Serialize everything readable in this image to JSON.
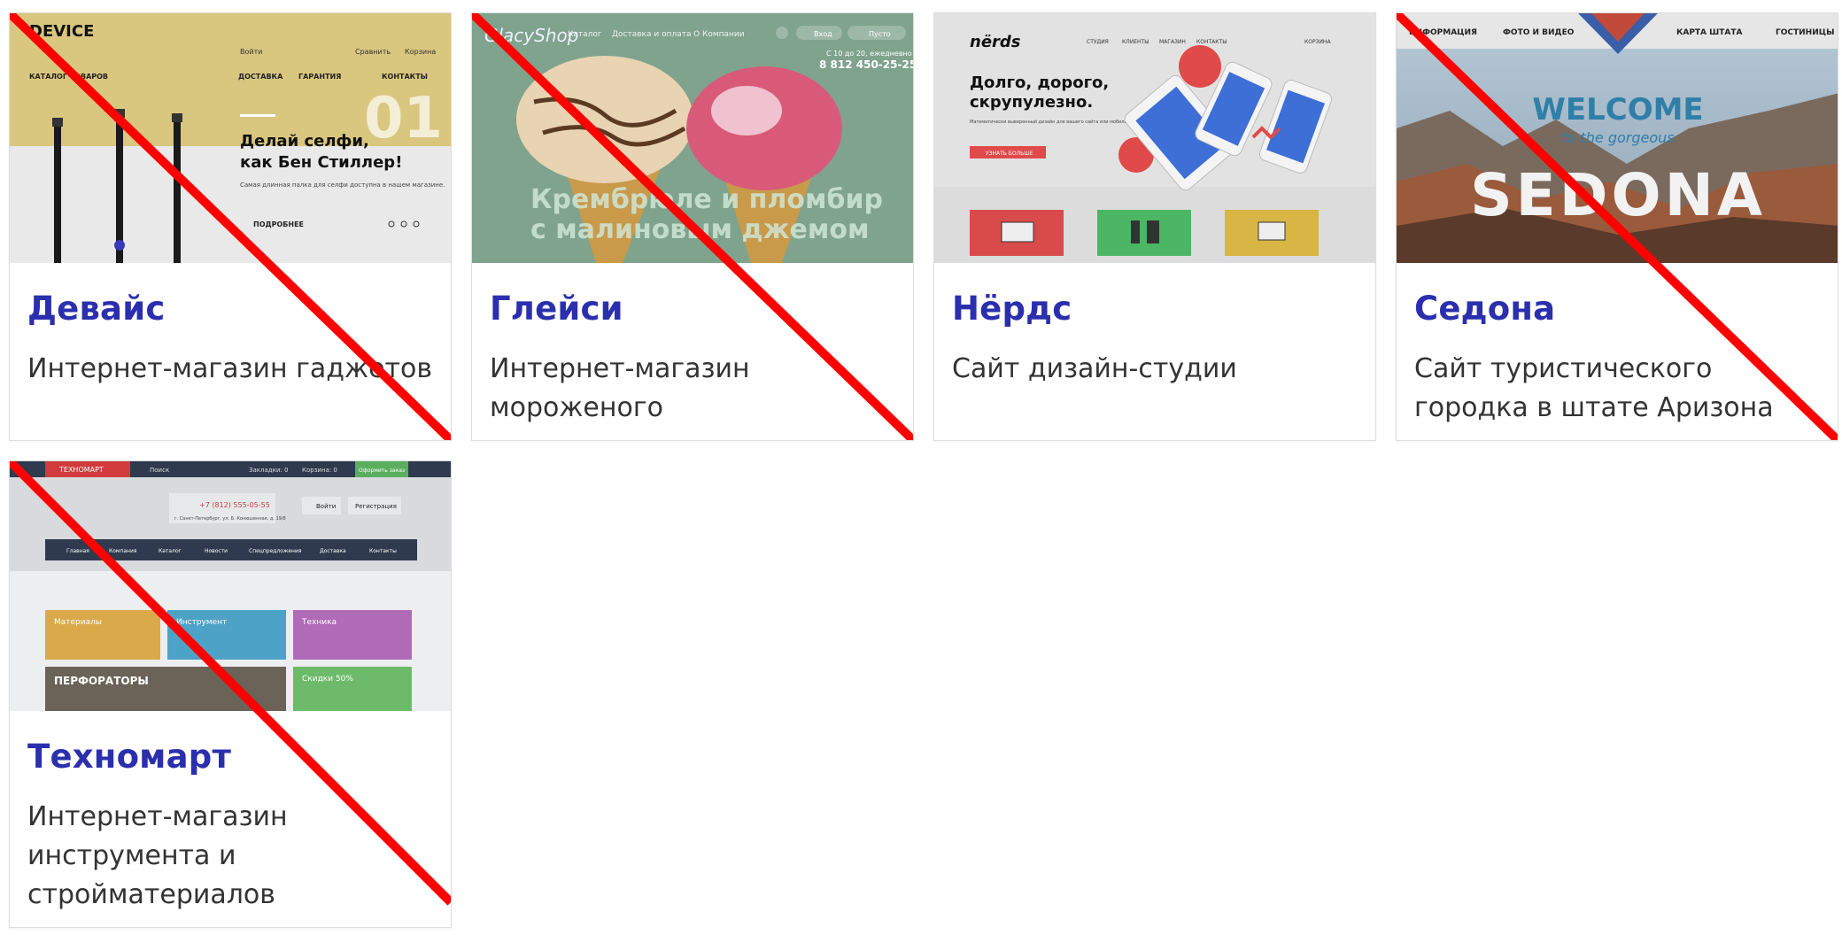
{
  "cards": [
    {
      "title": "Девайс",
      "description": "Интернет-магазин гаджетов",
      "crossed_out": true,
      "preview": {
        "logo": "DEVICE",
        "login": "Войти",
        "compare": "Сравнить",
        "cart": "Корзина",
        "catalog": "КАТАЛОГ ТОВАРОВ",
        "delivery": "ДОСТАВКА",
        "warranty": "ГАРАНТИЯ",
        "contacts": "КОНТАКТЫ",
        "slide_number": "01",
        "headline_1": "Делай селфи,",
        "headline_2": "как Бен Стиллер!",
        "text": "Самая длинная палка для селфи доступна в нашем магазине.",
        "more": "ПОДРОБНЕЕ"
      }
    },
    {
      "title": "Глейси",
      "description": "Интернет-магазин мороженого",
      "crossed_out": true,
      "preview": {
        "logo": "GlacyShop",
        "nav_catalog": "Каталог",
        "nav_delivery": "Доставка и оплата",
        "nav_about": "О Компании",
        "login": "Вход",
        "cart": "Пусто",
        "hours": "С 10 до 20, ежедневно",
        "phone": "8 812 450-25-25",
        "headline_1": "Крембрюле и пломбир",
        "headline_2": "с малиновым джемом"
      }
    },
    {
      "title": "Нёрдс",
      "description": "Сайт дизайн-студии",
      "crossed_out": false,
      "preview": {
        "logo": "nërds",
        "nav": [
          "СТУДИЯ",
          "КЛИЕНТЫ",
          "МАГАЗИН",
          "КОНТАКТЫ"
        ],
        "cart": "КОРЗИНА",
        "headline_1": "Долго, дорого,",
        "headline_2": "скрупулезно.",
        "text": "Математически выверенный дизайн для вашего сайта или мобильного приложения.",
        "button": "УЗНАТЬ БОЛЬШЕ"
      }
    },
    {
      "title": "Седона",
      "description": "Сайт туристического городка в штате Аризона",
      "crossed_out": true,
      "preview": {
        "nav": [
          "ИНФОРМАЦИЯ",
          "ФОТО И ВИДЕО",
          "КАРТА ШТАТА",
          "ГОСТИНИЦЫ"
        ],
        "welcome": "WELCOME",
        "tagline": "to the gorgeous",
        "city": "SEDONA"
      }
    },
    {
      "title": "Техномарт",
      "description": "Интернет-магазин инструмента и стройматериалов",
      "crossed_out": true,
      "preview": {
        "logo": "ТЕХНОМАРТ",
        "search": "Поиск",
        "bookmarks": "Закладки: 0",
        "cart": "Корзина: 0",
        "checkout": "Оформить заказ",
        "phone": "+7 (812) 555-05-55",
        "address": "г. Санкт-Петербург, ул. Б. Конюшенная, д. 19/8",
        "login": "Войти",
        "register": "Регистрация",
        "nav": [
          "Главная",
          "Компания",
          "Каталог",
          "Новости",
          "Спецпредложения",
          "Доставка",
          "Контакты"
        ],
        "tiles": [
          "Материалы",
          "Инструмент",
          "Техника",
          "ПЕРФОРАТОРЫ",
          "Скидки 50%"
        ]
      }
    }
  ],
  "colors": {
    "title": "#2b2fae",
    "description": "#333333",
    "strike": "#ff0000"
  }
}
